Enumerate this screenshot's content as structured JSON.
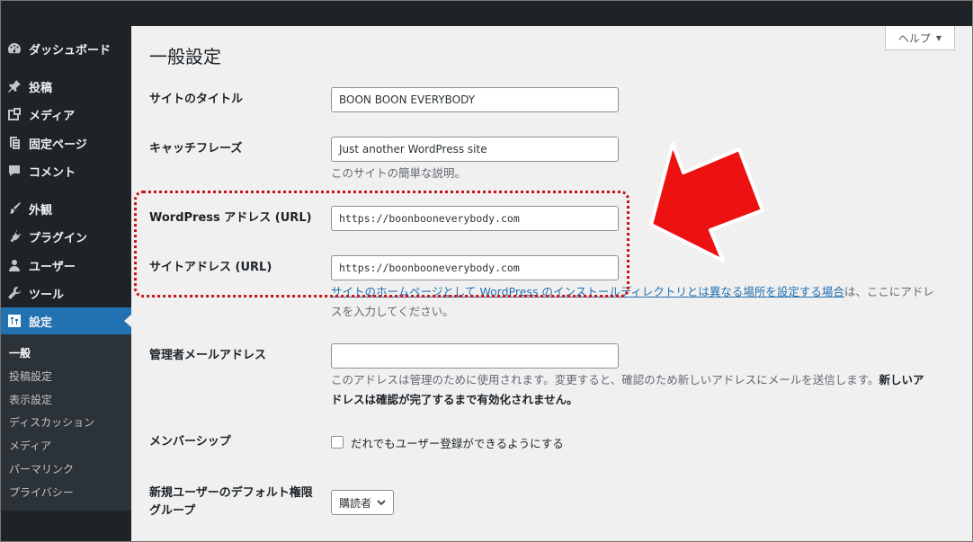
{
  "colors": {
    "sidebar_bg": "#1d2327",
    "accent": "#2271b1",
    "highlight_border": "#cc1111",
    "arrow_fill": "#ee1111"
  },
  "sidebar": {
    "items": [
      {
        "label": "ダッシュボード",
        "icon": "dashboard-icon"
      },
      {
        "label": "投稿",
        "icon": "pin-icon"
      },
      {
        "label": "メディア",
        "icon": "media-icon"
      },
      {
        "label": "固定ページ",
        "icon": "page-icon"
      },
      {
        "label": "コメント",
        "icon": "comment-icon"
      },
      {
        "label": "外観",
        "icon": "brush-icon"
      },
      {
        "label": "プラグイン",
        "icon": "plugin-icon"
      },
      {
        "label": "ユーザー",
        "icon": "user-icon"
      },
      {
        "label": "ツール",
        "icon": "wrench-icon"
      },
      {
        "label": "設定",
        "icon": "settings-icon",
        "active": true
      }
    ],
    "submenu": [
      "一般",
      "投稿設定",
      "表示設定",
      "ディスカッション",
      "メディア",
      "パーマリンク",
      "プライバシー"
    ]
  },
  "help": {
    "label": "ヘルプ",
    "caret": "▼"
  },
  "page": {
    "title": "一般設定"
  },
  "fields": {
    "site_title": {
      "label": "サイトのタイトル",
      "value": "BOON BOON EVERYBODY"
    },
    "tagline": {
      "label": "キャッチフレーズ",
      "value": "Just another WordPress site",
      "desc": "このサイトの簡単な説明。"
    },
    "wp_address": {
      "label": "WordPress アドレス (URL)",
      "value": "https://boonbooneverybody.com"
    },
    "site_address": {
      "label": "サイトアドレス (URL)",
      "value": "https://boonbooneverybody.com",
      "desc_link": "サイトのホームページとして WordPress のインストールディレクトリとは異なる場所を設定する場合",
      "desc_rest_1": "は、ここにアドレ",
      "desc_rest_2": "スを入力してください。"
    },
    "admin_email": {
      "label": "管理者メールアドレス",
      "value": "",
      "desc_1a": "このアドレスは管理のために使用されます。変更すると、確認のため新しいアドレスにメールを送信します。",
      "desc_1b": "新しいア",
      "desc_2": "ドレスは確認が完了するまで有効化されません。"
    },
    "membership": {
      "label": "メンバーシップ",
      "checkbox_label": "だれでもユーザー登録ができるようにする",
      "checked": false
    },
    "default_role": {
      "label_1": "新規ユーザーのデフォルト権限",
      "label_2": "グループ",
      "value": "購読者"
    }
  }
}
